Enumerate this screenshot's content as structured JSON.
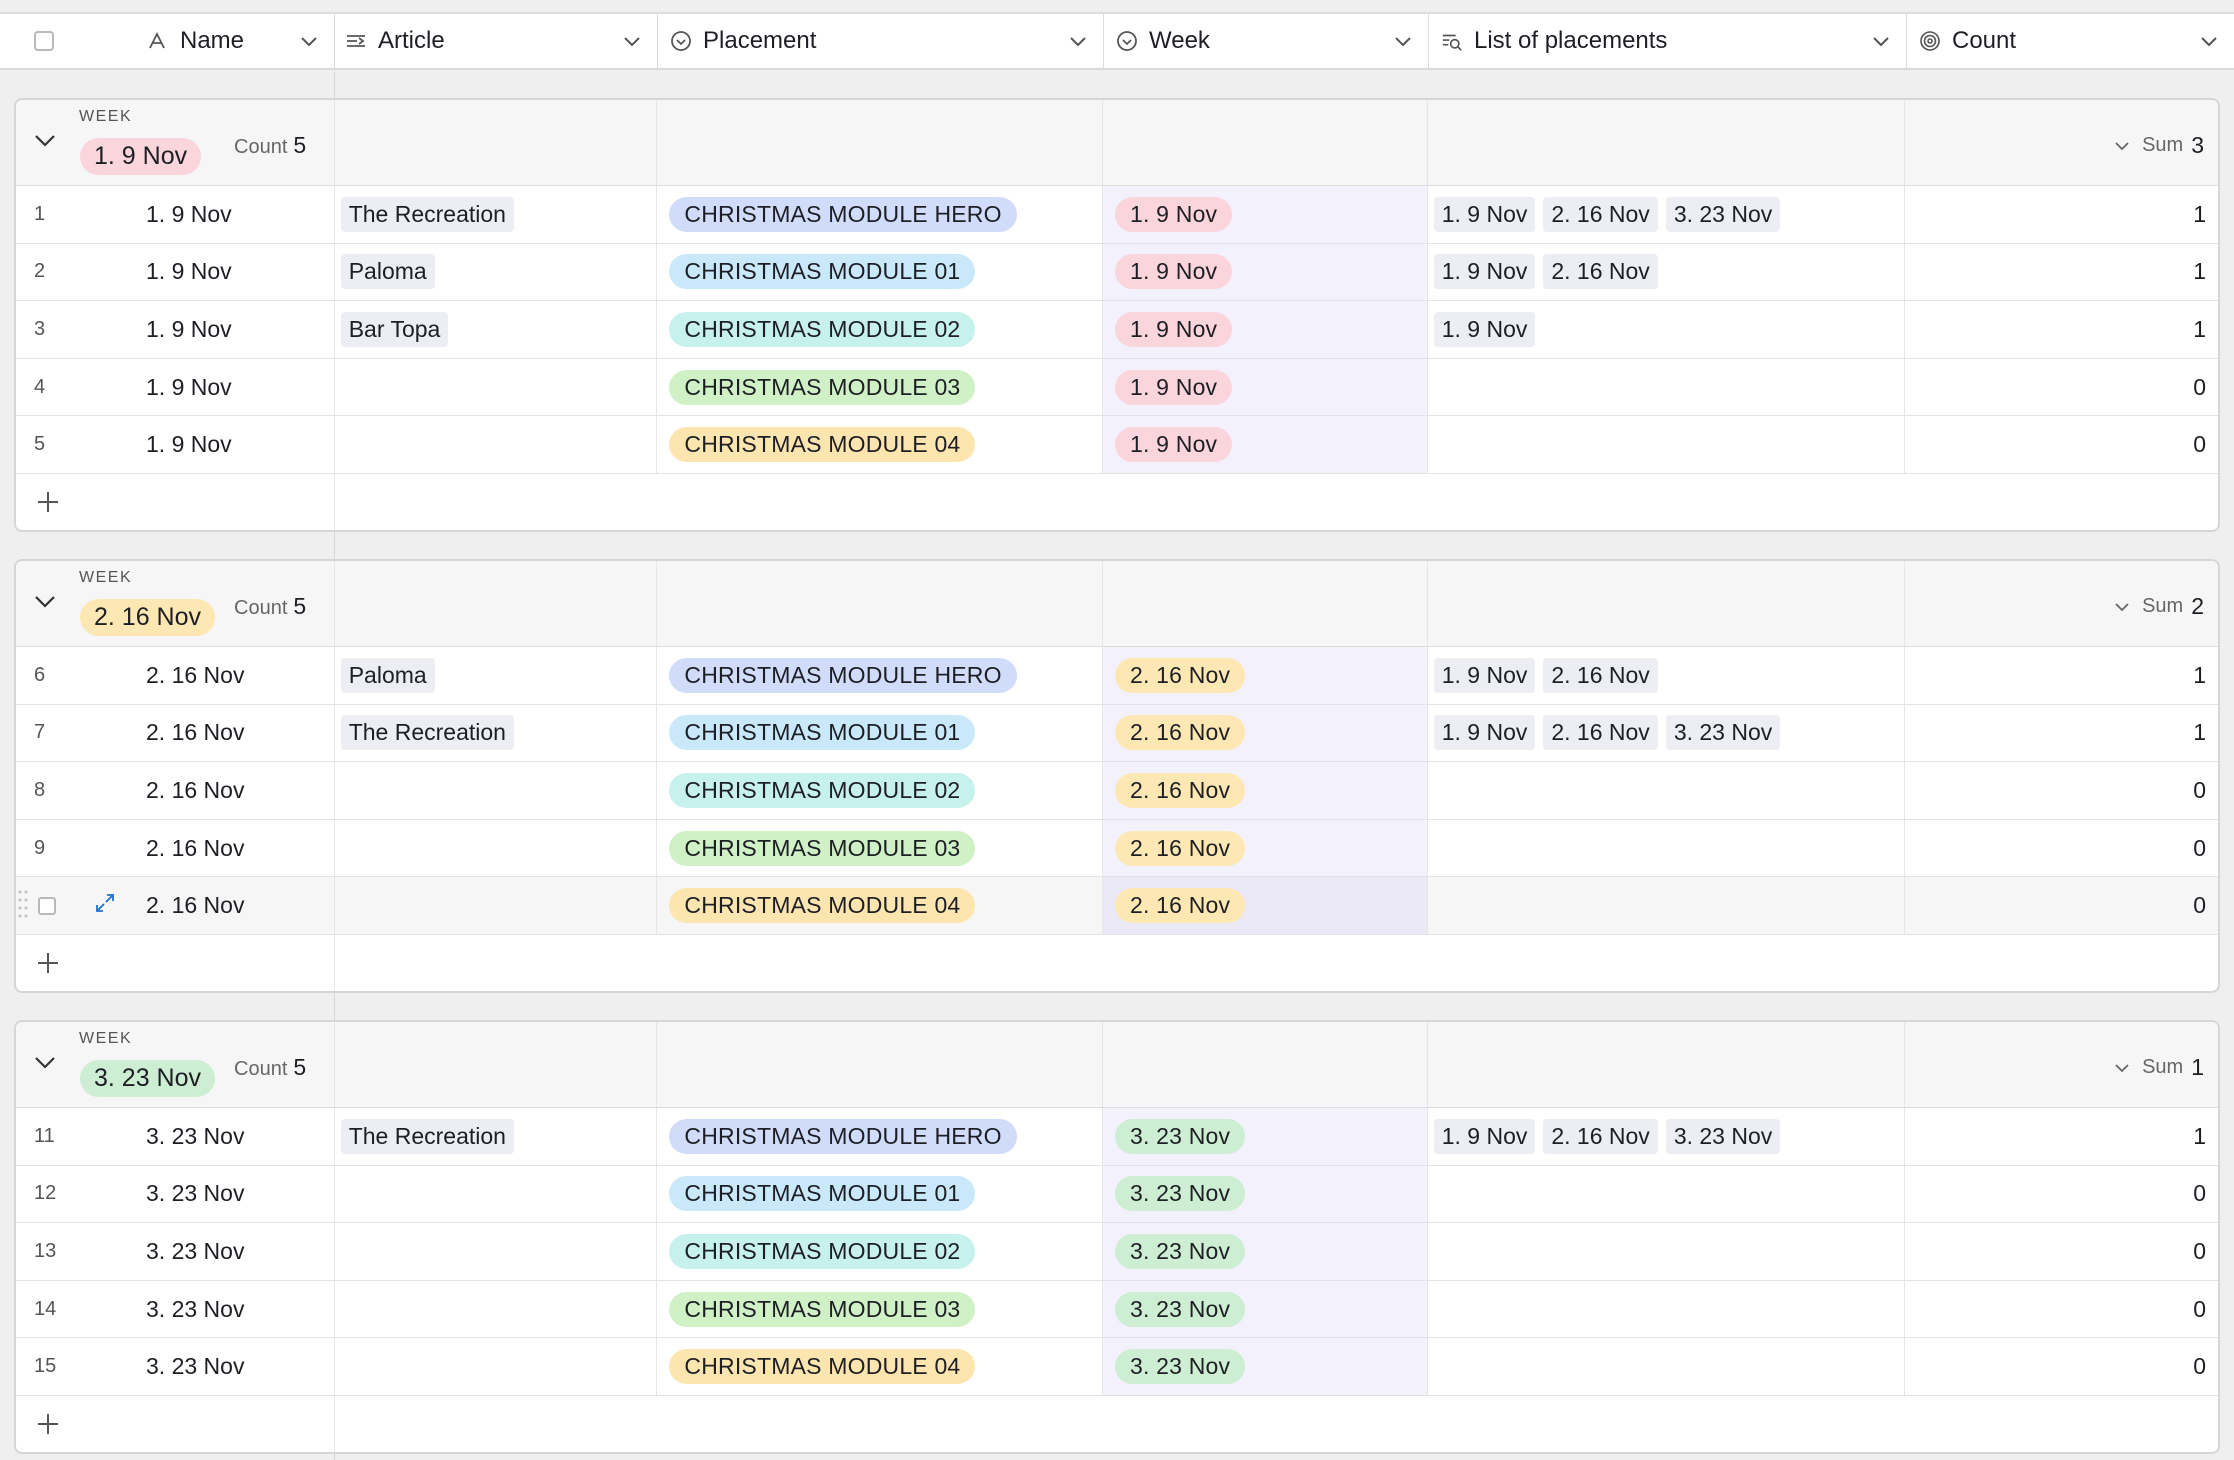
{
  "header": {
    "columns": [
      {
        "label": "Name",
        "icon": "text-field-icon"
      },
      {
        "label": "Article",
        "icon": "linked-record-icon"
      },
      {
        "label": "Placement",
        "icon": "single-select-icon"
      },
      {
        "label": "Week",
        "icon": "single-select-icon"
      },
      {
        "label": "List of placements",
        "icon": "lookup-icon"
      },
      {
        "label": "Count",
        "icon": "rollup-icon"
      }
    ]
  },
  "colors": {
    "week1": "#fbd5dc",
    "week2": "#fde7b3",
    "week3": "#cdeed3",
    "hero": "#d1dcfb",
    "m01": "#c9e9fb",
    "m02": "#c7f1ec",
    "m03": "#d0f0c6",
    "m04": "#fde5b0"
  },
  "groups": [
    {
      "label": "WEEK",
      "value": "1. 9 Nov",
      "color": "week1",
      "count_label": "Count",
      "count": "5",
      "sum_label": "Sum",
      "sum": "3",
      "rows": [
        {
          "num": "1",
          "name": "1. 9 Nov",
          "article": "The Recreation",
          "placement": "CHRISTMAS MODULE HERO",
          "pcolor": "hero",
          "week": "1. 9 Nov",
          "list": [
            "1. 9 Nov",
            "2. 16 Nov",
            "3. 23 Nov"
          ],
          "count": "1"
        },
        {
          "num": "2",
          "name": "1. 9 Nov",
          "article": "Paloma",
          "placement": "CHRISTMAS MODULE 01",
          "pcolor": "m01",
          "week": "1. 9 Nov",
          "list": [
            "1. 9 Nov",
            "2. 16 Nov"
          ],
          "count": "1"
        },
        {
          "num": "3",
          "name": "1. 9 Nov",
          "article": "Bar Topa",
          "placement": "CHRISTMAS MODULE 02",
          "pcolor": "m02",
          "week": "1. 9 Nov",
          "list": [
            "1. 9 Nov"
          ],
          "count": "1"
        },
        {
          "num": "4",
          "name": "1. 9 Nov",
          "article": "",
          "placement": "CHRISTMAS MODULE 03",
          "pcolor": "m03",
          "week": "1. 9 Nov",
          "list": [],
          "count": "0"
        },
        {
          "num": "5",
          "name": "1. 9 Nov",
          "article": "",
          "placement": "CHRISTMAS MODULE 04",
          "pcolor": "m04",
          "week": "1. 9 Nov",
          "list": [],
          "count": "0"
        }
      ]
    },
    {
      "label": "WEEK",
      "value": "2. 16 Nov",
      "color": "week2",
      "count_label": "Count",
      "count": "5",
      "sum_label": "Sum",
      "sum": "2",
      "rows": [
        {
          "num": "6",
          "name": "2. 16 Nov",
          "article": "Paloma",
          "placement": "CHRISTMAS MODULE HERO",
          "pcolor": "hero",
          "week": "2. 16 Nov",
          "list": [
            "1. 9 Nov",
            "2. 16 Nov"
          ],
          "count": "1"
        },
        {
          "num": "7",
          "name": "2. 16 Nov",
          "article": "The Recreation",
          "placement": "CHRISTMAS MODULE 01",
          "pcolor": "m01",
          "week": "2. 16 Nov",
          "list": [
            "1. 9 Nov",
            "2. 16 Nov",
            "3. 23 Nov"
          ],
          "count": "1"
        },
        {
          "num": "8",
          "name": "2. 16 Nov",
          "article": "",
          "placement": "CHRISTMAS MODULE 02",
          "pcolor": "m02",
          "week": "2. 16 Nov",
          "list": [],
          "count": "0"
        },
        {
          "num": "9",
          "name": "2. 16 Nov",
          "article": "",
          "placement": "CHRISTMAS MODULE 03",
          "pcolor": "m03",
          "week": "2. 16 Nov",
          "list": [],
          "count": "0"
        },
        {
          "num": "",
          "name": "2. 16 Nov",
          "article": "",
          "placement": "CHRISTMAS MODULE 04",
          "pcolor": "m04",
          "week": "2. 16 Nov",
          "list": [],
          "count": "0",
          "hover": true
        }
      ]
    },
    {
      "label": "WEEK",
      "value": "3. 23 Nov",
      "color": "week3",
      "count_label": "Count",
      "count": "5",
      "sum_label": "Sum",
      "sum": "1",
      "rows": [
        {
          "num": "11",
          "name": "3. 23 Nov",
          "article": "The Recreation",
          "placement": "CHRISTMAS MODULE HERO",
          "pcolor": "hero",
          "week": "3. 23 Nov",
          "list": [
            "1. 9 Nov",
            "2. 16 Nov",
            "3. 23 Nov"
          ],
          "count": "1"
        },
        {
          "num": "12",
          "name": "3. 23 Nov",
          "article": "",
          "placement": "CHRISTMAS MODULE 01",
          "pcolor": "m01",
          "week": "3. 23 Nov",
          "list": [],
          "count": "0"
        },
        {
          "num": "13",
          "name": "3. 23 Nov",
          "article": "",
          "placement": "CHRISTMAS MODULE 02",
          "pcolor": "m02",
          "week": "3. 23 Nov",
          "list": [],
          "count": "0"
        },
        {
          "num": "14",
          "name": "3. 23 Nov",
          "article": "",
          "placement": "CHRISTMAS MODULE 03",
          "pcolor": "m03",
          "week": "3. 23 Nov",
          "list": [],
          "count": "0"
        },
        {
          "num": "15",
          "name": "3. 23 Nov",
          "article": "",
          "placement": "CHRISTMAS MODULE 04",
          "pcolor": "m04",
          "week": "3. 23 Nov",
          "list": [],
          "count": "0"
        }
      ]
    }
  ]
}
